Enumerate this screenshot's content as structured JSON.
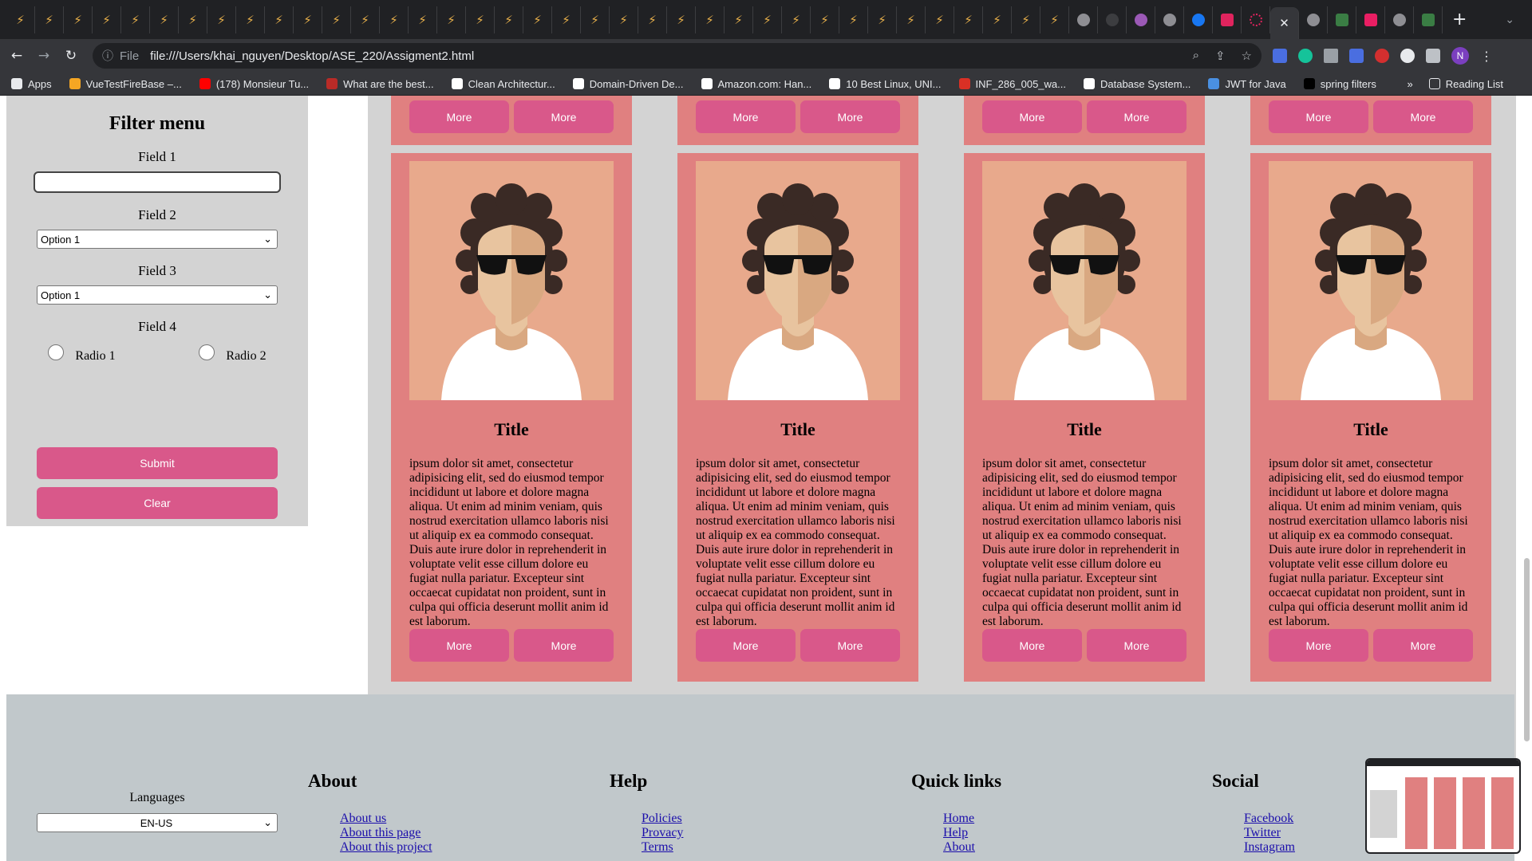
{
  "browser": {
    "url_scheme": "File",
    "url": "file:///Users/khai_nguyen/Desktop/ASE_220/Assigment2.html",
    "profile_initial": "N",
    "bookmarks": [
      {
        "label": "Apps",
        "color": "#e8eaed"
      },
      {
        "label": "VueTestFireBase –...",
        "color": "#f5a623"
      },
      {
        "label": "(178) Monsieur Tu...",
        "color": "#ff0000"
      },
      {
        "label": "What are the best...",
        "color": "#b92b27"
      },
      {
        "label": "Clean Architectur...",
        "color": "#ffffff"
      },
      {
        "label": "Domain-Driven De...",
        "color": "#ffffff"
      },
      {
        "label": "Amazon.com: Han...",
        "color": "#ffffff"
      },
      {
        "label": "10 Best Linux, UNI...",
        "color": "#ffffff"
      },
      {
        "label": "INF_286_005_wa...",
        "color": "#d93025"
      },
      {
        "label": "Database System...",
        "color": "#ffffff"
      },
      {
        "label": "JWT for Java",
        "color": "#4a90e2"
      },
      {
        "label": "spring filters",
        "color": "#000000"
      }
    ],
    "bookmarks_overflow": "»",
    "reading_list": "Reading List"
  },
  "filter": {
    "title": "Filter menu",
    "field1_label": "Field 1",
    "field1_value": "",
    "field2_label": "Field 2",
    "field2_value": "Option 1",
    "field3_label": "Field 3",
    "field3_value": "Option 1",
    "field4_label": "Field 4",
    "radio1": "Radio 1",
    "radio2": "Radio 2",
    "submit": "Submit",
    "clear": "Clear"
  },
  "cards": {
    "more_label": "More",
    "title": "Title",
    "body": "ipsum dolor sit amet, consectetur adipisicing elit, sed do eiusmod tempor incididunt ut labore et dolore magna aliqua. Ut enim ad minim veniam, quis nostrud exercitation ullamco laboris nisi ut aliquip ex ea commodo consequat. Duis aute irure dolor in reprehenderit in voluptate velit esse cillum dolore eu fugiat nulla pariatur. Excepteur sint occaecat cupidatat non proident, sunt in culpa qui officia deserunt mollit anim id est laborum."
  },
  "footer": {
    "languages_label": "Languages",
    "language_value": "EN-US",
    "about": {
      "title": "About",
      "links": [
        "About us",
        "About this page",
        "About this project"
      ]
    },
    "help": {
      "title": "Help",
      "links": [
        "Policies",
        "Provacy",
        "Terms"
      ]
    },
    "quick": {
      "title": "Quick links",
      "links": [
        "Home",
        "Help",
        "About"
      ]
    },
    "social": {
      "title": "Social",
      "links": [
        "Facebook",
        "Twitter",
        "Instagram"
      ]
    }
  }
}
